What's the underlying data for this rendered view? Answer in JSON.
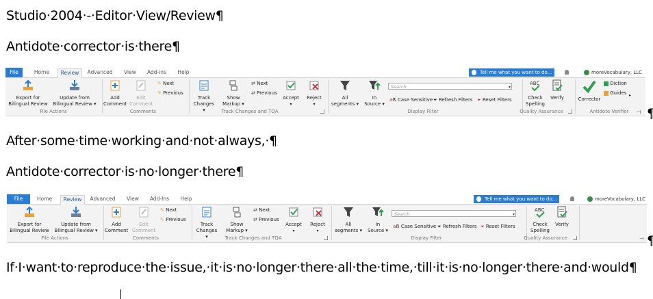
{
  "doc": {
    "line1": "Studio·2004·-·Editor·View/Review¶",
    "line2": "Antidote·corrector·is·there¶",
    "line3": "After·some·time·working·and·not·always,·¶",
    "line4": "Antidote·corrector·is·no·longer·there¶",
    "line5": "If·I·want·to·reproduce·the·issue,·it·is·no·longer·there·all·the·time,·till·it·is·no·longer·there·and·would¶",
    "pilcrow": "¶"
  },
  "ribbon_before": {
    "tabs": [
      "File",
      "Home",
      "Review",
      "Advanced",
      "View",
      "Add-ins",
      "Help"
    ],
    "active_tab": "Review",
    "tell_me": "Tell me what you want to do...",
    "account": "moreVocabulary, LLC",
    "search_placeholder": "Search",
    "export_line1": "Export for",
    "export_line2": "Bilingual Review",
    "update_line1": "Update from",
    "update_line2": "Bilingual Review ▾",
    "add_line1": "Add",
    "add_line2": "Comment",
    "edit_line1": "Edit",
    "edit_line2": "Comment",
    "next": "Next",
    "previous": "Previous",
    "track_line1": "Track",
    "track_line2": "Changes ▾",
    "show_line1": "Show",
    "show_line2": "Markup ▾",
    "next2": "Next",
    "previous2": "Previous",
    "accept": "Accept",
    "reject": "Reject",
    "all_line1": "All",
    "all_line2": "segments ▾",
    "in_line1": "In",
    "in_line2": "Source ▾",
    "case_sensitive": "Case Sensitive",
    "refresh_filters": "Refresh Filters",
    "reset_filters": "Reset Filters",
    "check_line1": "Check",
    "check_line2": "Spelling",
    "verify": "Verify",
    "corrector": "Corrector",
    "dictionaries": "Diction",
    "guides": "Guides",
    "groups": {
      "file_actions": "File Actions",
      "comments": "Comments",
      "track_changes": "Track Changes and TQA",
      "display_filter": "Display Filter",
      "quality_assurance": "Quality Assurance",
      "antidote_verifier": "Antidote Verifier"
    }
  },
  "ribbon_after": {
    "tabs": [
      "File",
      "Home",
      "Review",
      "Advanced",
      "View",
      "Add-Ins",
      "Help"
    ],
    "active_tab": "Review",
    "tell_me": "Tell me what you want to do...",
    "account": "moreVocabulary, LLC",
    "search_placeholder": "Search",
    "export_line1": "Export for",
    "export_line2": "Bilingual Review",
    "update_line1": "Update from",
    "update_line2": "Bilingual Review ▾",
    "add_line1": "Add",
    "add_line2": "Comment",
    "edit_line1": "Edit",
    "edit_line2": "Comment",
    "next": "Next",
    "previous": "Previous",
    "track_line1": "Track",
    "track_line2": "Changes ▾",
    "show_line1": "Show",
    "show_line2": "Markup ▾",
    "next2": "Next",
    "previous2": "Previous",
    "accept": "Accept",
    "reject": "Reject",
    "all_line1": "All",
    "all_line2": "segments ▾",
    "in_line1": "In",
    "in_line2": "Source ▾",
    "case_sensitive": "Case Sensitive",
    "refresh_filters": "Refresh Filters",
    "reset_filters": "Reset Filters",
    "check_line1": "Check",
    "check_line2": "Spelling",
    "verify": "Verify",
    "groups": {
      "file_actions": "File Actions",
      "comments": "Comments",
      "track_changes": "Track Changes and TQA",
      "display_filter": "Display Filter",
      "quality_assurance": "Quality Assurance"
    }
  },
  "colors": {
    "accent": "#2b7cd3",
    "ribbon_bg": "#f3f3f3",
    "check_green": "#2e9e4f",
    "reject_red": "#d13438"
  }
}
